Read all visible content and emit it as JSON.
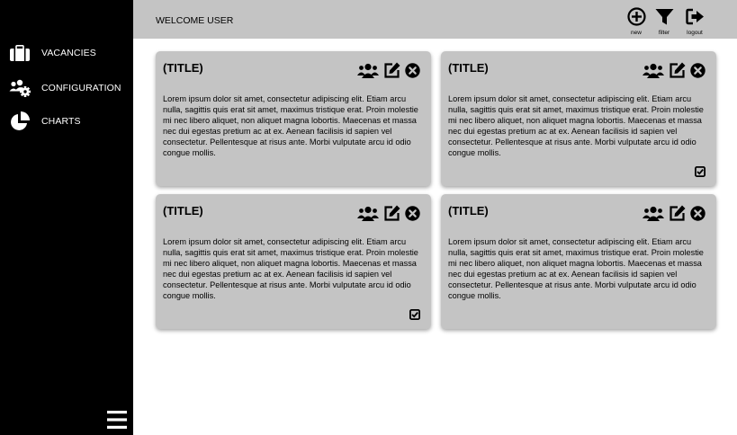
{
  "sidebar": {
    "items": [
      {
        "label": "VACANCIES",
        "icon": "briefcase-icon"
      },
      {
        "label": "CONFIGURATION",
        "icon": "users-gear-icon"
      },
      {
        "label": "CHARTS",
        "icon": "pie-chart-icon"
      }
    ],
    "menu_icon": "hamburger-menu-icon"
  },
  "header": {
    "welcome": "WELCOME USER",
    "actions": [
      {
        "label": "new",
        "icon": "plus-circle-icon"
      },
      {
        "label": "filter",
        "icon": "filter-icon"
      },
      {
        "label": "logout",
        "icon": "logout-icon"
      }
    ]
  },
  "cards": [
    {
      "title": "(TITLE)",
      "body": "Lorem ipsum dolor sit amet, consectetur adipiscing elit. Etiam arcu nulla, sagittis quis erat sit amet, maximus tristique erat. Proin molestie mi nec libero aliquet, non aliquet magna lobortis. Maecenas et massa nec dui egestas pretium ac at ex. Aenean facilisis id sapien vel consectetur. Pellentesque at risus ante. Morbi vulputate arcu id odio congue mollis.",
      "checked": false
    },
    {
      "title": "(TITLE)",
      "body": "Lorem ipsum dolor sit amet, consectetur adipiscing elit. Etiam arcu nulla, sagittis quis erat sit amet, maximus tristique erat. Proin molestie mi nec libero aliquet, non aliquet magna lobortis. Maecenas et massa nec dui egestas pretium ac at ex. Aenean facilisis id sapien vel consectetur. Pellentesque at risus ante. Morbi vulputate arcu id odio congue mollis.",
      "checked": true
    },
    {
      "title": "(TITLE)",
      "body": "Lorem ipsum dolor sit amet, consectetur adipiscing elit. Etiam arcu nulla, sagittis quis erat sit amet, maximus tristique erat. Proin molestie mi nec libero aliquet, non aliquet magna lobortis. Maecenas et massa nec dui egestas pretium ac at ex. Aenean facilisis id sapien vel consectetur. Pellentesque at risus ante. Morbi vulputate arcu id odio congue mollis.",
      "checked": true
    },
    {
      "title": "(TITLE)",
      "body": "Lorem ipsum dolor sit amet, consectetur adipiscing elit. Etiam arcu nulla, sagittis quis erat sit amet, maximus tristique erat. Proin molestie mi nec libero aliquet, non aliquet magna lobortis. Maecenas et massa nec dui egestas pretium ac at ex. Aenean facilisis id sapien vel consectetur. Pellentesque at risus ante. Morbi vulputate arcu id odio congue mollis.",
      "checked": false
    }
  ],
  "card_action_icons": [
    "team-icon",
    "edit-icon",
    "close-circle-icon"
  ],
  "card_check_icon": "checkbox-checked-icon",
  "colors": {
    "sidebar": "#000000",
    "surface": "#c4c4c4",
    "background": "#ffffff",
    "text": "#000000"
  }
}
